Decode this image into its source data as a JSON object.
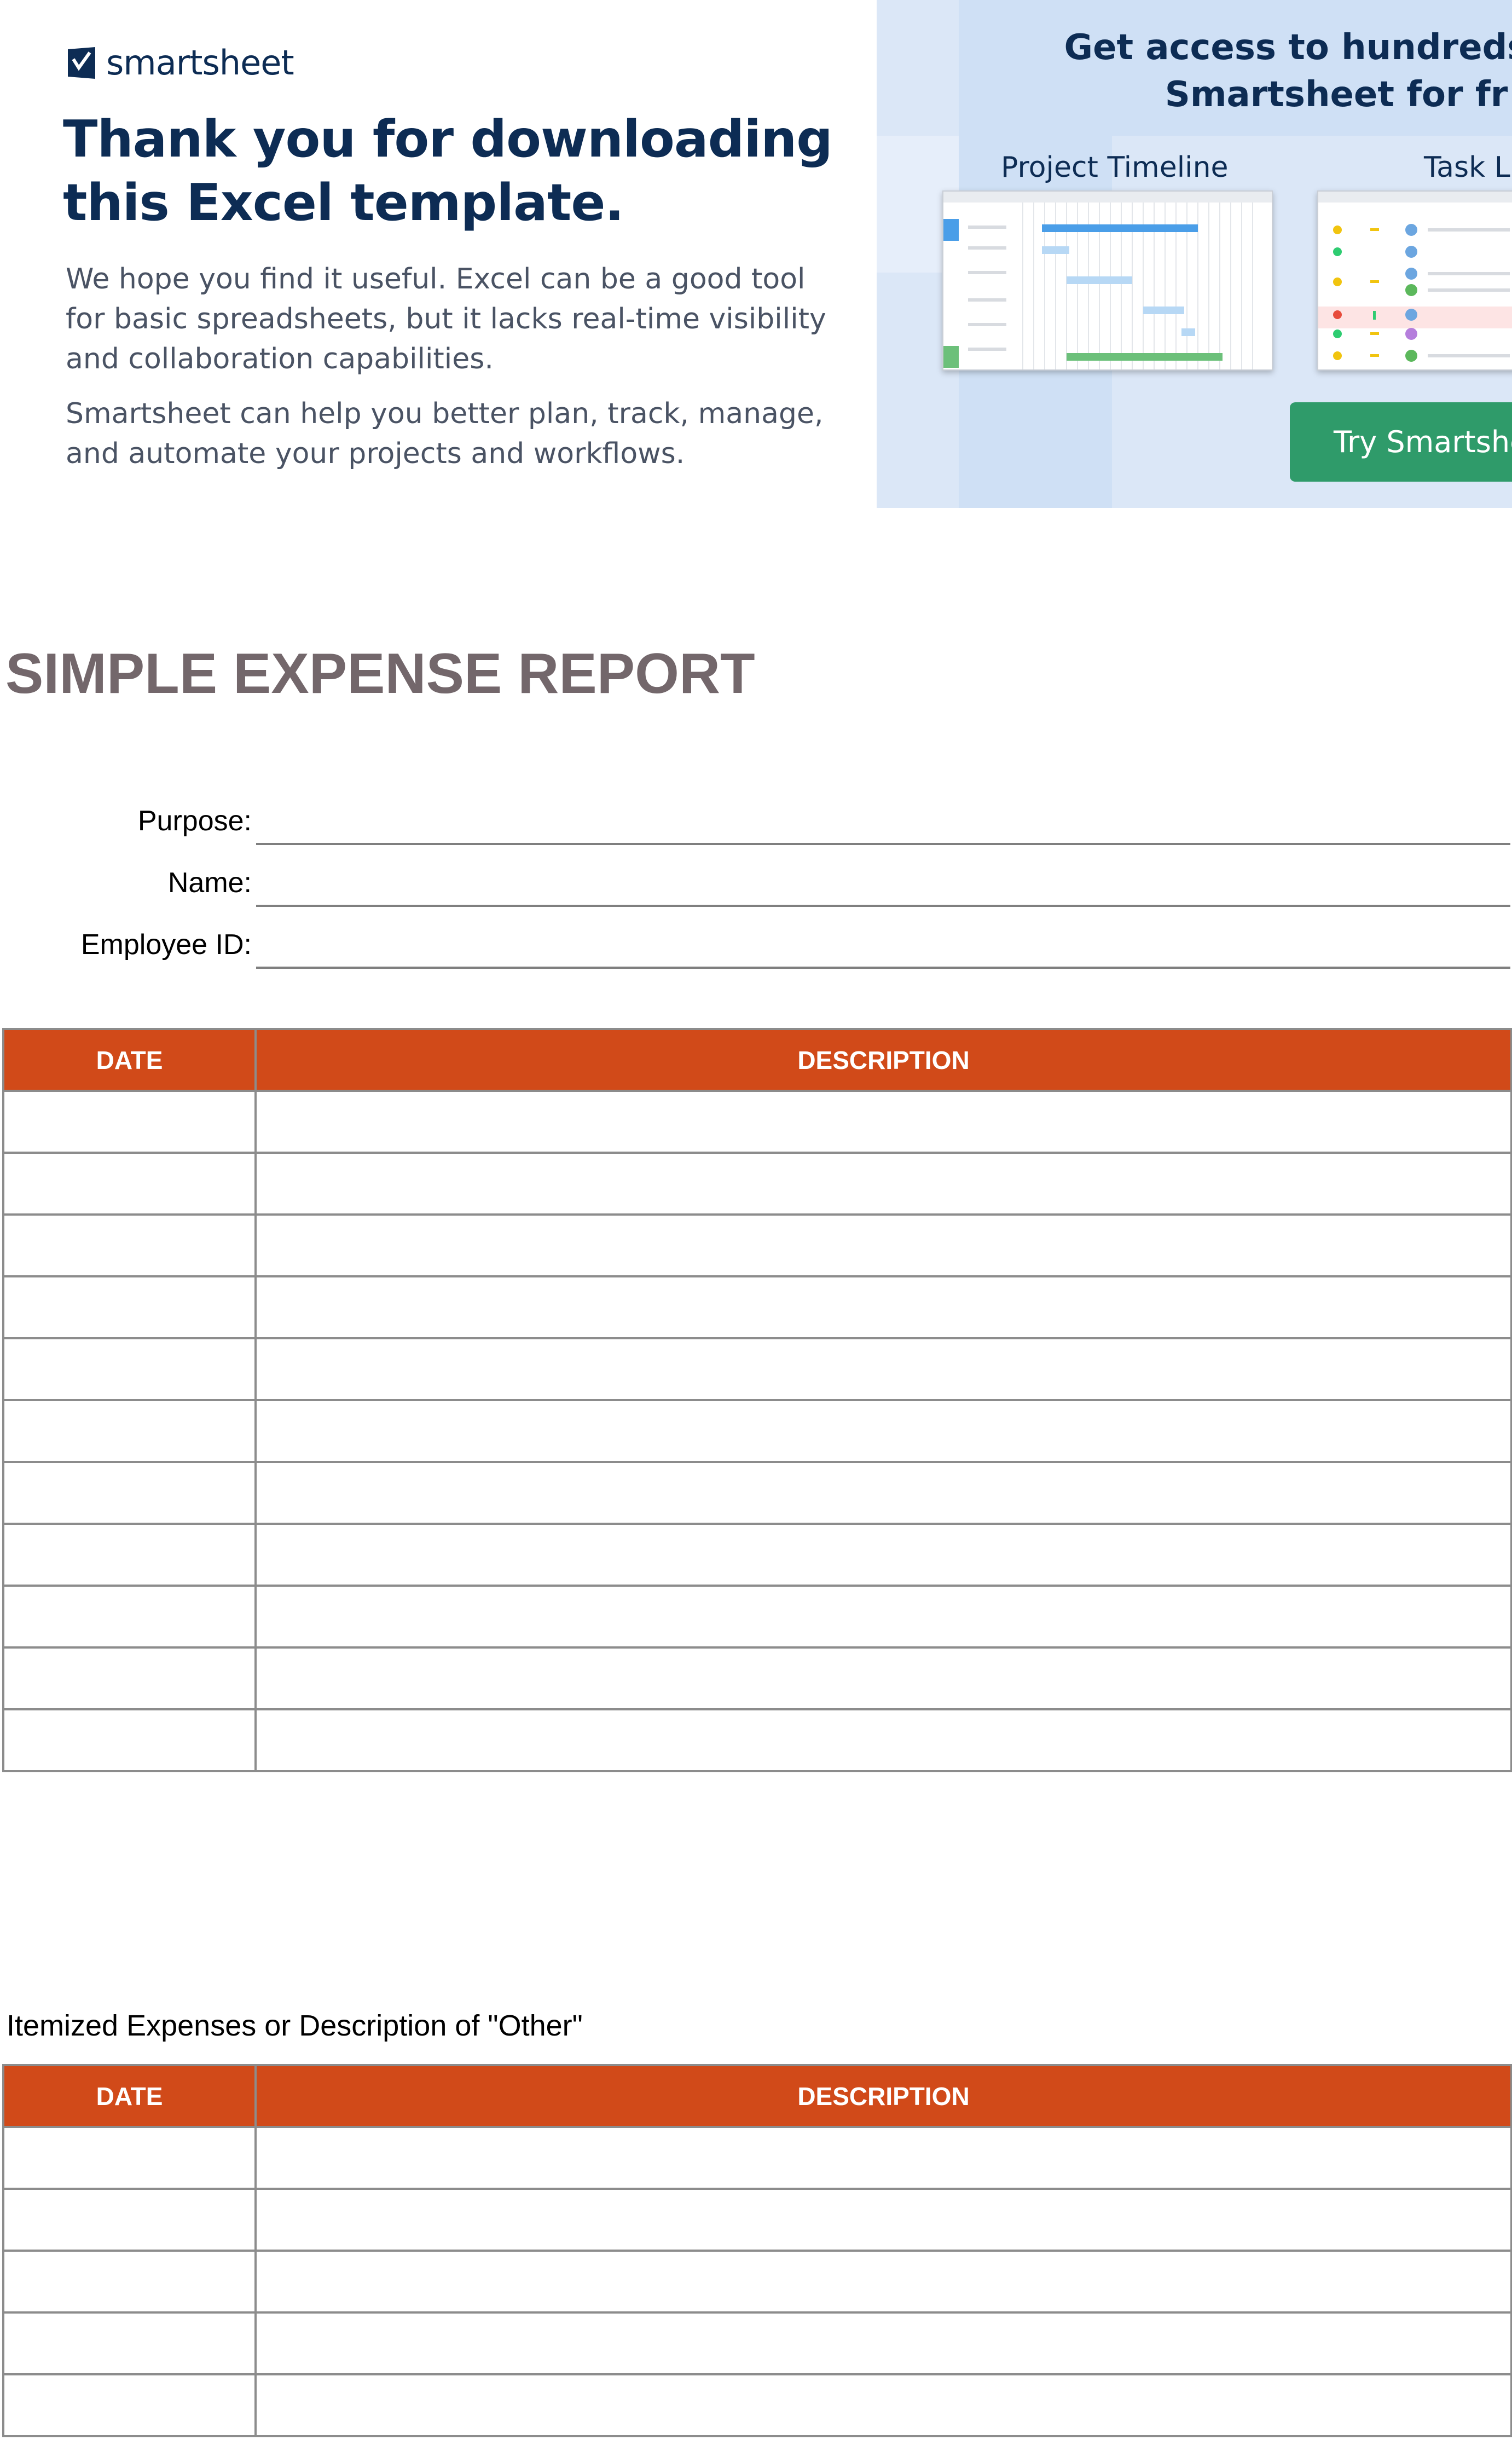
{
  "banner": {
    "logo_text": "smartsheet",
    "heading": "Thank you for downloading this Excel template.",
    "paragraph_1": "We hope you find it useful. Excel can be a good tool for basic spreadsheets, but it lacks real-time visibility and collaboration capabilities.",
    "paragraph_2": "Smartsheet can help you better plan, track, manage, and automate your projects and workflows.",
    "panel_title": "Get access to hundreds of t\nSmartsheet for fr",
    "label_timeline": "Project Timeline",
    "label_tasklist": "Task Li",
    "cta_label": "Try Smartshee",
    "colors": {
      "navy": "#0d2c54",
      "cta_green": "#2f9b6a",
      "panel_blue": "#dbe7f7"
    }
  },
  "report": {
    "title": "SIMPLE EXPENSE REPORT",
    "fields": {
      "purpose_label": "Purpose:",
      "name_label": "Name:",
      "employee_id_label": "Employee ID:"
    },
    "main_table": {
      "headers": {
        "date": "DATE",
        "description": "DESCRIPTION"
      },
      "empty_row_count": 11
    },
    "itemized_label": "Itemized Expenses or Description of \"Other\"",
    "itemized_table": {
      "headers": {
        "date": "DATE",
        "description": "DESCRIPTION"
      },
      "empty_row_count": 5
    },
    "colors": {
      "header_orange": "#d14a19",
      "title_gray": "#73676b",
      "border_gray": "#8c8c8c"
    }
  }
}
